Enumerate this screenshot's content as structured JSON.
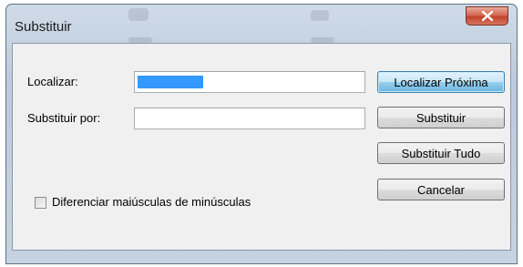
{
  "window": {
    "title": "Substituir",
    "close_icon": "close-icon"
  },
  "form": {
    "find_label": "Localizar:",
    "find_value": "",
    "find_selection": "selected-text-highlight",
    "replace_label": "Substituir por:",
    "replace_value": ""
  },
  "buttons": {
    "find_next": "Localizar Próxima",
    "replace": "Substituir",
    "replace_all": "Substituir Tudo",
    "cancel": "Cancelar"
  },
  "options": {
    "match_case_label": "Diferenciar maiúsculas de minúsculas",
    "match_case_checked": false
  },
  "colors": {
    "selection": "#3399ff",
    "close_button": "#c2432c",
    "default_button_border": "#3c7fb1"
  }
}
